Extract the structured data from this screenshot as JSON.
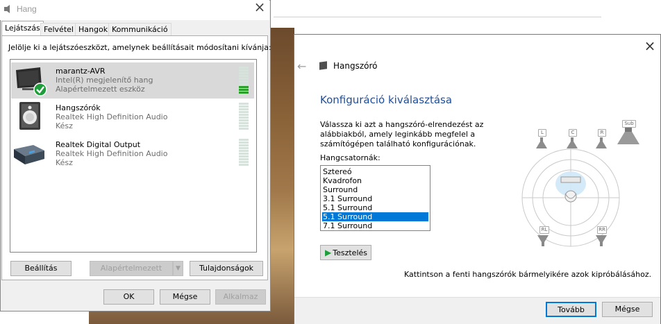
{
  "sound_dialog": {
    "title": "Hang",
    "tabs": [
      "Lejátszás",
      "Felvétel",
      "Hangok",
      "Kommunikáció"
    ],
    "instruction": "Jelölje ki a lejátszóeszközt, amelynek beállításait módosítani kívánja:",
    "devices": [
      {
        "name": "marantz-AVR",
        "line1": "Intel(R) megjelenítő hang",
        "line2": "Alapértelmezett eszköz",
        "icon": "tv-monitor-icon"
      },
      {
        "name": "Hangszórók",
        "line1": "Realtek High Definition Audio",
        "line2": "Kész",
        "icon": "speaker-icon"
      },
      {
        "name": "Realtek Digital Output",
        "line1": "Realtek High Definition Audio",
        "line2": "Kész",
        "icon": "digital-output-icon"
      }
    ],
    "buttons": {
      "configure": "Beállítás",
      "set_default": "Alapértelmezett",
      "properties": "Tulajdonságok",
      "ok": "OK",
      "cancel": "Mégse",
      "apply": "Alkalmaz"
    }
  },
  "speaker_setup": {
    "window_title": "Hangszóró",
    "heading": "Konfiguráció kiválasztása",
    "description": "Válassza ki azt a hangszóró-elrendezést az alábbiakból, amely leginkább megfelel a számítógépen található konfigurációnak.",
    "channels_label": "Hangcsatornák:",
    "channels": [
      "Sztereó",
      "Kvadrofon",
      "Surround",
      "3.1 Surround",
      "5.1 Surround",
      "5.1 Surround",
      "7.1 Surround"
    ],
    "selected_index": 5,
    "test_button": "Tesztelés",
    "footer_note": "Kattintson a fenti hangszórók bármelyikére azok kipróbálásához.",
    "next_button": "Tovább",
    "cancel_button": "Mégse",
    "speaker_labels": {
      "left": "L",
      "center": "C",
      "right": "R",
      "sub": "Sub",
      "rear_left": "RL",
      "rear_right": "RR"
    }
  },
  "colors": {
    "selection": "#0078d7",
    "heading": "#1d4fa0",
    "check_green": "#1e9e3a"
  }
}
